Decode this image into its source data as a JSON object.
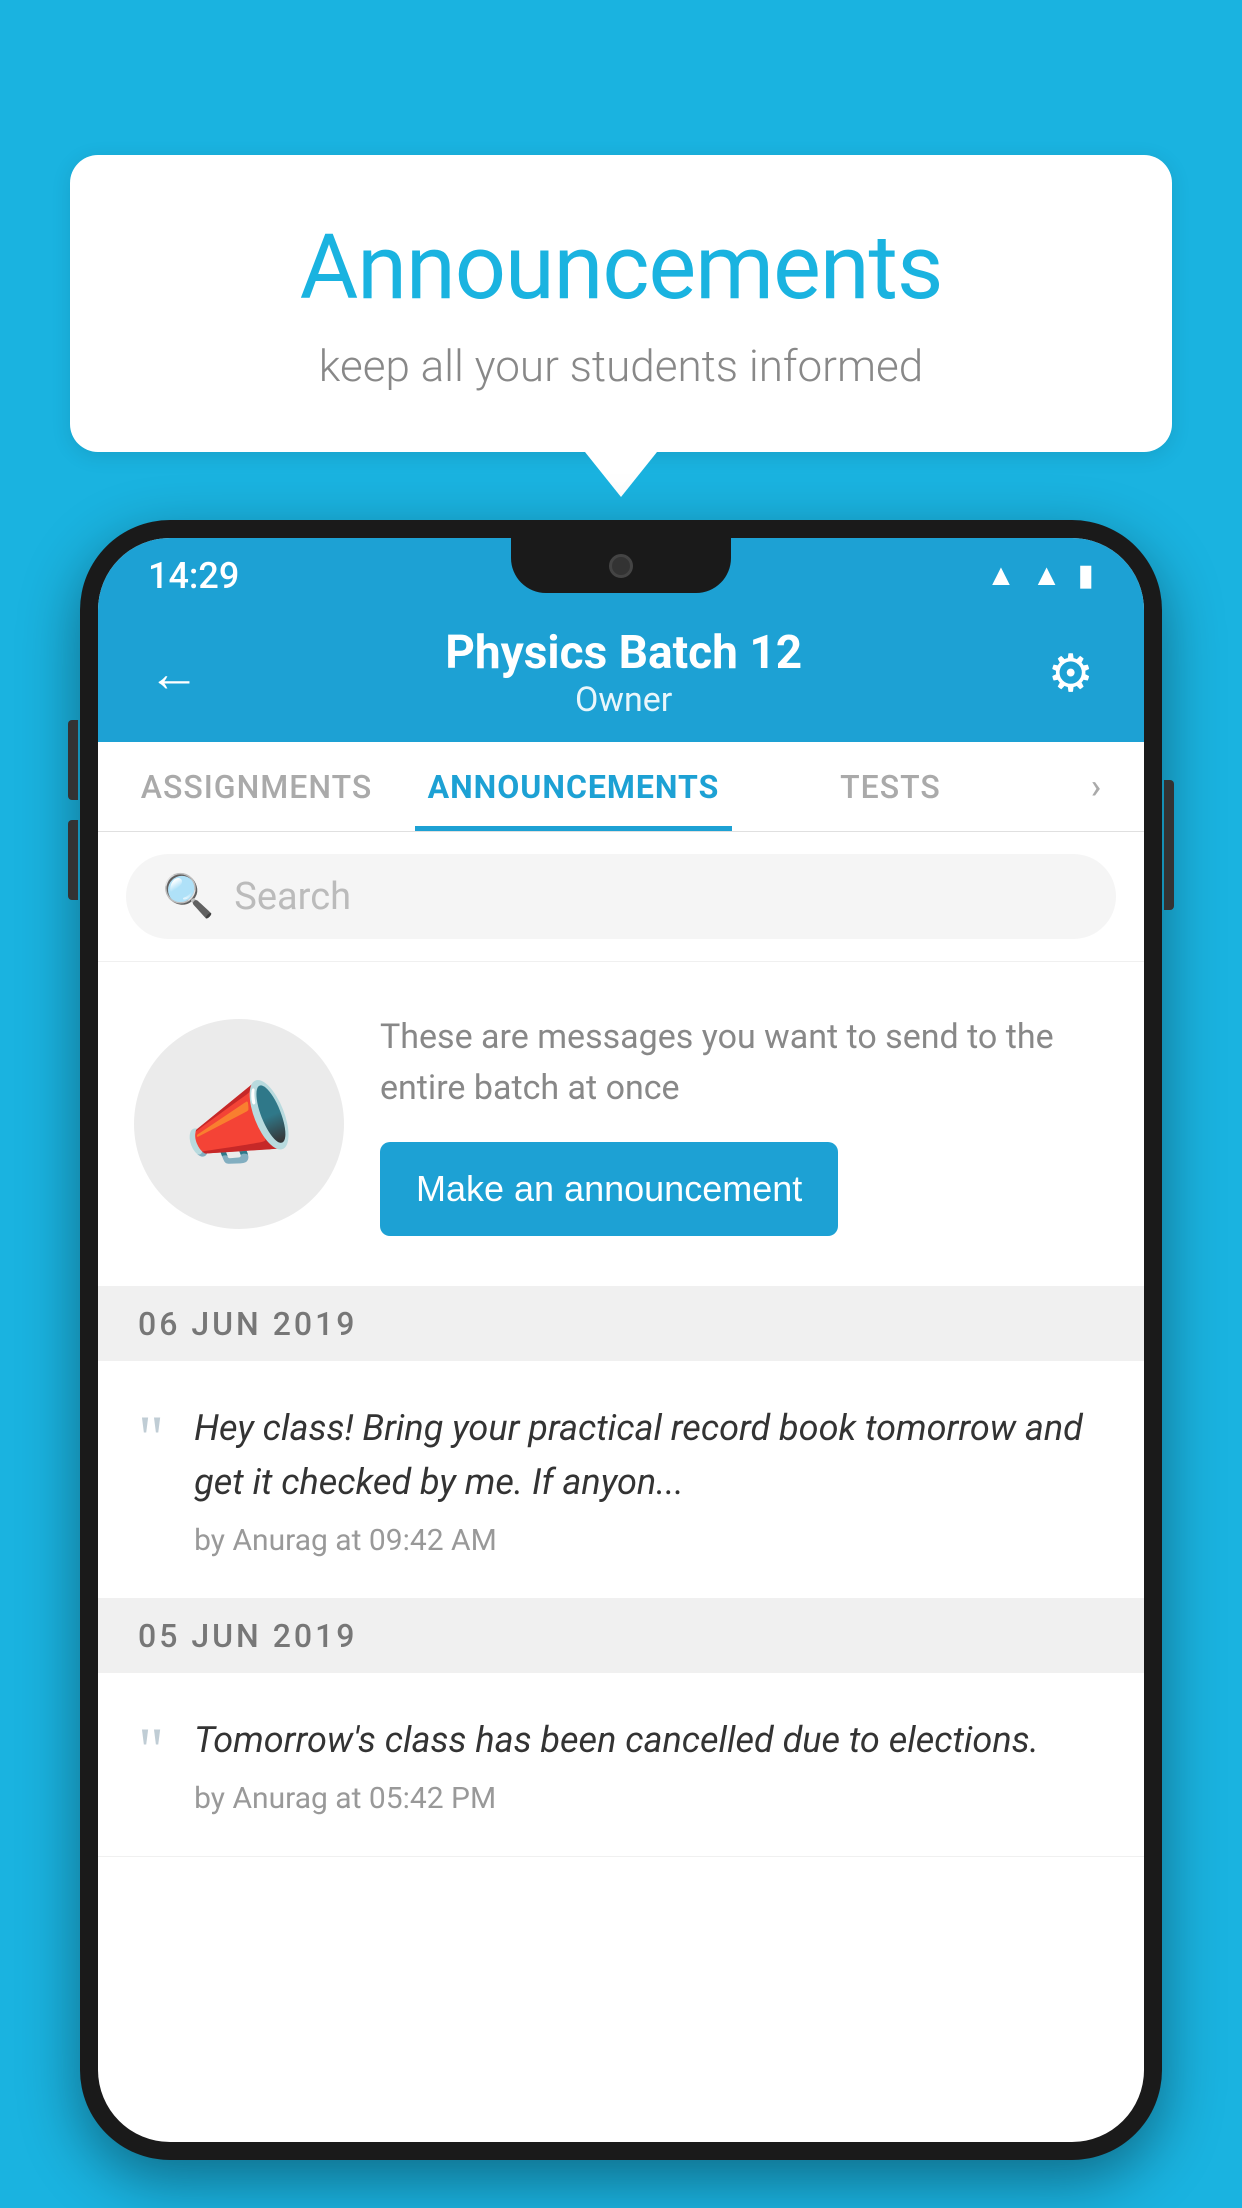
{
  "page": {
    "background_color": "#1ab3e0"
  },
  "speech_bubble": {
    "title": "Announcements",
    "subtitle": "keep all your students informed"
  },
  "status_bar": {
    "time": "14:29",
    "icons": [
      "wifi",
      "signal",
      "battery"
    ]
  },
  "app_header": {
    "title": "Physics Batch 12",
    "subtitle": "Owner",
    "back_label": "←",
    "gear_label": "⚙"
  },
  "tabs": [
    {
      "label": "ASSIGNMENTS",
      "active": false
    },
    {
      "label": "ANNOUNCEMENTS",
      "active": true
    },
    {
      "label": "TESTS",
      "active": false
    },
    {
      "label": "...",
      "active": false
    }
  ],
  "search": {
    "placeholder": "Search"
  },
  "promo": {
    "description": "These are messages you want to send to the entire batch at once",
    "button_label": "Make an announcement"
  },
  "announcements": [
    {
      "date": "06  JUN  2019",
      "items": [
        {
          "text": "Hey class! Bring your practical record book tomorrow and get it checked by me. If anyon...",
          "meta": "by Anurag at 09:42 AM"
        }
      ]
    },
    {
      "date": "05  JUN  2019",
      "items": [
        {
          "text": "Tomorrow's class has been cancelled due to elections.",
          "meta": "by Anurag at 05:42 PM"
        }
      ]
    }
  ]
}
